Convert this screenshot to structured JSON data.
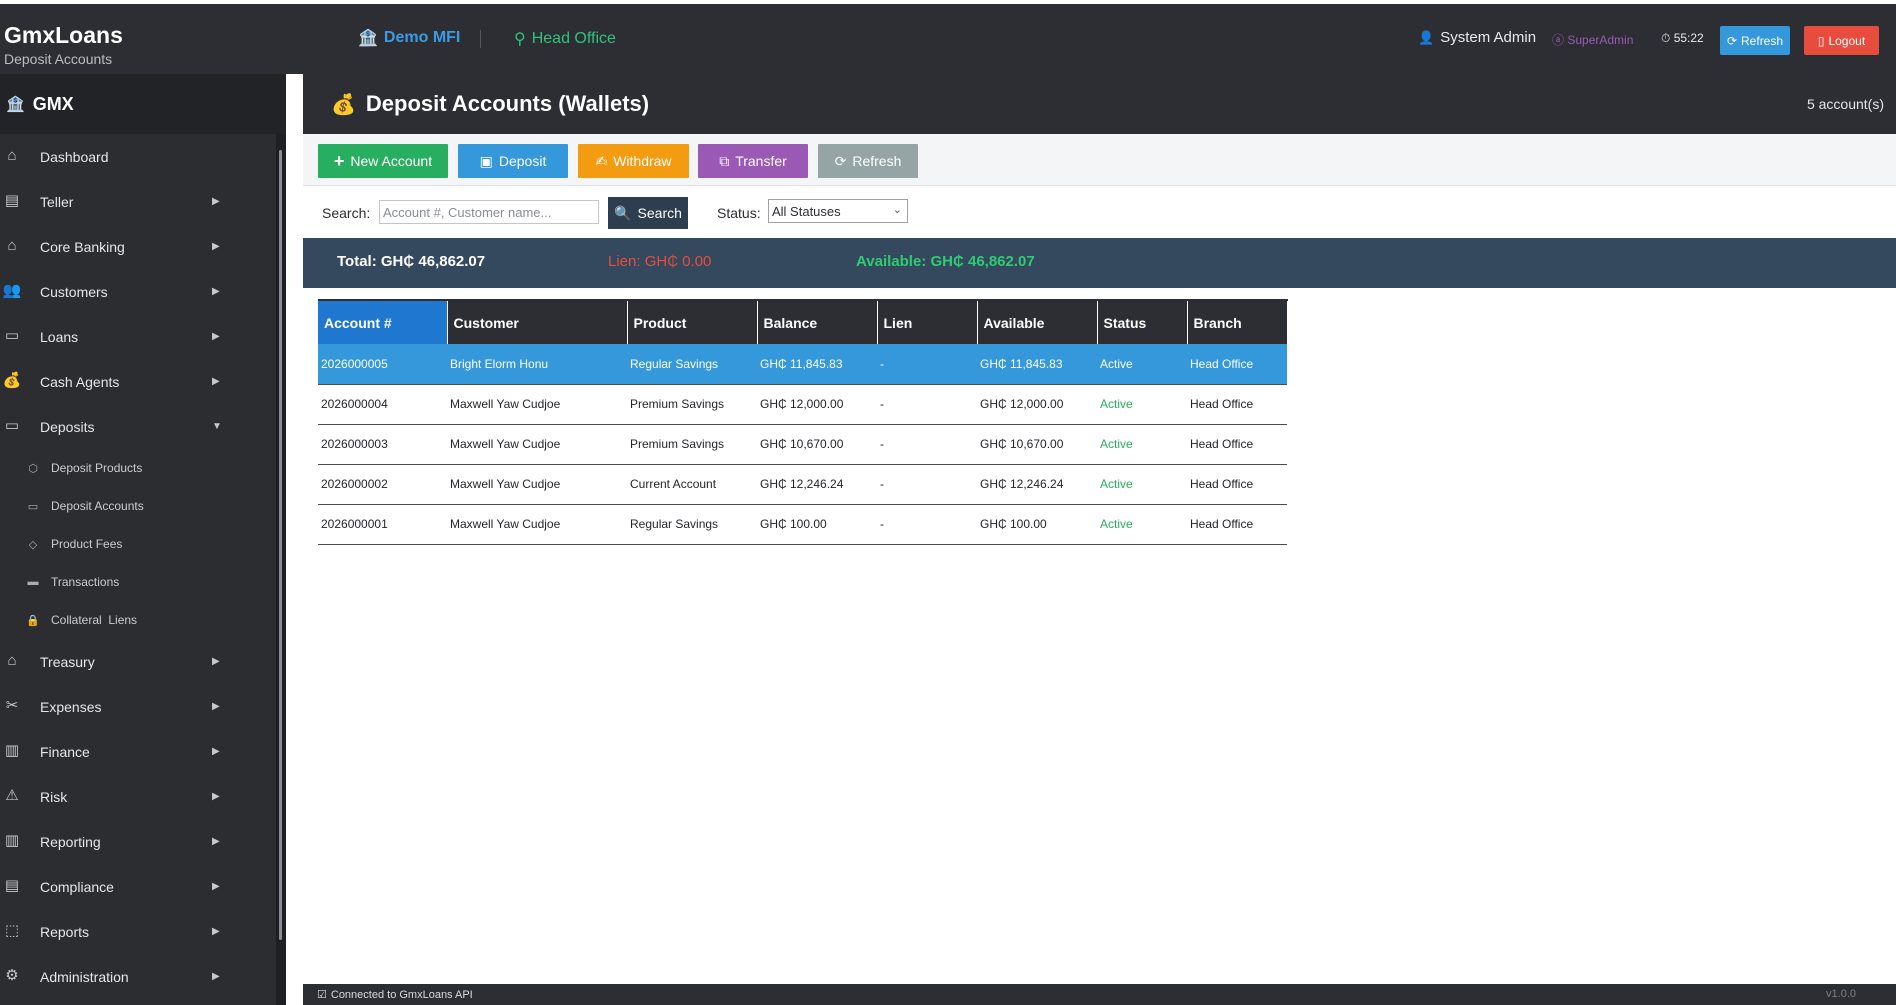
{
  "app": {
    "name": "GmxLoans",
    "subtitle": "Deposit Accounts",
    "org": "Demo MFI",
    "branch": "Head Office",
    "user": "System Admin",
    "role": "SuperAdmin",
    "session_timer": "55:22",
    "refresh_label": "Refresh",
    "logout_label": "Logout"
  },
  "sidebar": {
    "brand": "GMX",
    "items": [
      {
        "label": "Dashboard",
        "icon": "dashboard-icon"
      },
      {
        "label": "Teller",
        "icon": "teller-icon"
      },
      {
        "label": "Core Banking",
        "icon": "bank-icon"
      },
      {
        "label": "Customers",
        "icon": "users-icon"
      },
      {
        "label": "Loans",
        "icon": "loan-icon"
      },
      {
        "label": "Cash Agents",
        "icon": "money-bag-icon"
      },
      {
        "label": "Deposits",
        "icon": "deposit-icon"
      },
      {
        "label": "Treasury",
        "icon": "treasury-icon"
      },
      {
        "label": "Expenses",
        "icon": "expenses-icon"
      },
      {
        "label": "Finance",
        "icon": "finance-icon"
      },
      {
        "label": "Risk",
        "icon": "warning-icon"
      },
      {
        "label": "Reporting",
        "icon": "reporting-icon"
      },
      {
        "label": "Compliance",
        "icon": "compliance-icon"
      },
      {
        "label": "Reports",
        "icon": "reports-icon"
      },
      {
        "label": "Administration",
        "icon": "gear-icon"
      }
    ],
    "deposits_sub": [
      {
        "label": "Deposit Products",
        "icon": "box-icon"
      },
      {
        "label": "Deposit Accounts",
        "icon": "folder-icon"
      },
      {
        "label": "Product Fees",
        "icon": "tag-icon"
      },
      {
        "label": "Transactions",
        "icon": "card-icon"
      },
      {
        "label": "Collateral  Liens",
        "icon": "lock-icon"
      }
    ]
  },
  "page": {
    "title": "Deposit Accounts (Wallets)",
    "account_count": "5 account(s)"
  },
  "toolbar": {
    "new_account": "New Account",
    "deposit": "Deposit",
    "withdraw": "Withdraw",
    "transfer": "Transfer",
    "refresh": "Refresh"
  },
  "search": {
    "label": "Search:",
    "placeholder": "Account #, Customer name...",
    "button": "Search",
    "status_label": "Status:",
    "status_value": "All Statuses"
  },
  "summary": {
    "total": "Total: GH₵ 46,862.07",
    "lien": "Lien: GH₵ 0.00",
    "available": "Available: GH₵ 46,862.07"
  },
  "table": {
    "columns": [
      "Account #",
      "Customer",
      "Product",
      "Balance",
      "Lien",
      "Available",
      "Status",
      "Branch"
    ],
    "rows": [
      [
        "2026000005",
        "Bright Elorm Honu",
        "Regular Savings",
        "GH₵ 11,845.83",
        "-",
        "GH₵ 11,845.83",
        "Active",
        "Head Office"
      ],
      [
        "2026000004",
        "Maxwell Yaw Cudjoe",
        "Premium Savings",
        "GH₵ 12,000.00",
        "-",
        "GH₵ 12,000.00",
        "Active",
        "Head Office"
      ],
      [
        "2026000003",
        "Maxwell Yaw Cudjoe",
        "Premium Savings",
        "GH₵ 10,670.00",
        "-",
        "GH₵ 10,670.00",
        "Active",
        "Head Office"
      ],
      [
        "2026000002",
        "Maxwell Yaw Cudjoe",
        "Current Account",
        "GH₵ 12,246.24",
        "-",
        "GH₵ 12,246.24",
        "Active",
        "Head Office"
      ],
      [
        "2026000001",
        "Maxwell Yaw Cudjoe",
        "Regular Savings",
        "GH₵ 100.00",
        "-",
        "GH₵ 100.00",
        "Active",
        "Head Office"
      ]
    ]
  },
  "statusbar": {
    "text": "Connected to GmxLoans API",
    "version": "v1.0.0"
  },
  "colors": {
    "accent": "#3498db",
    "success": "#27ae60",
    "danger": "#e74c3c",
    "warning": "#f39c12",
    "purple": "#9b59b6"
  }
}
